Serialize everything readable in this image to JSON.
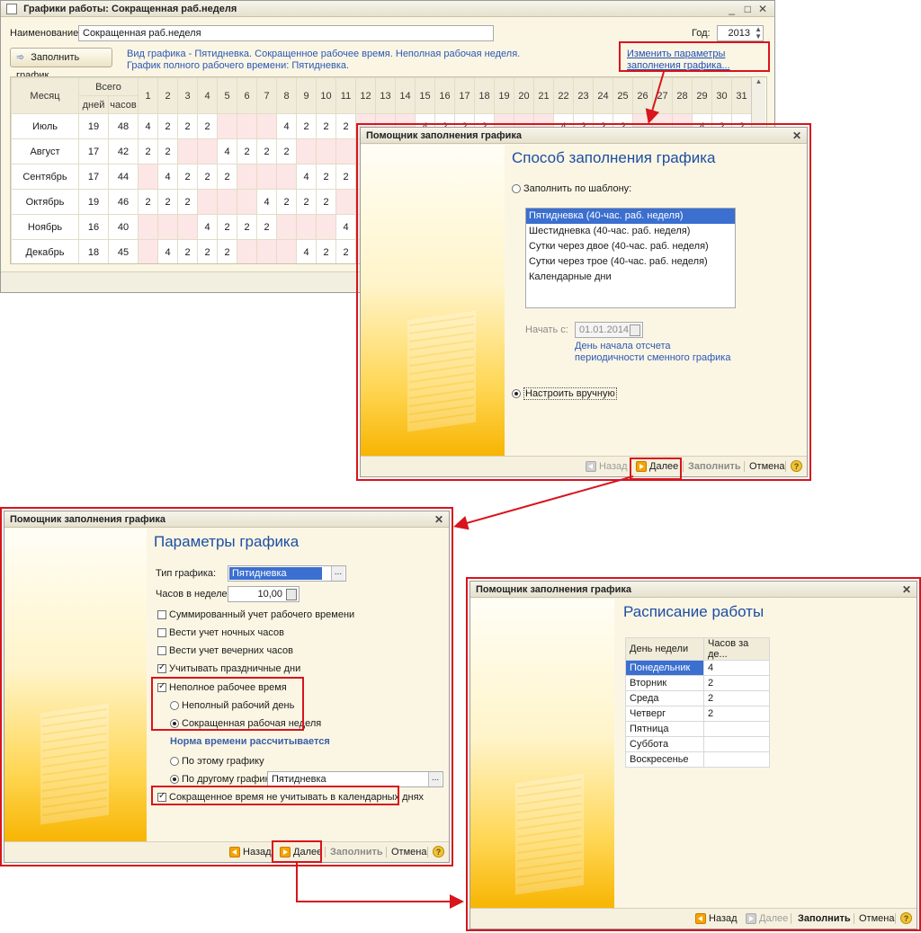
{
  "main": {
    "title": "Графики работы: Сокращенная раб.неделя",
    "name_label": "Наименование:",
    "name_value": "Сокращенная раб.неделя",
    "year_label": "Год:",
    "year_value": "2013",
    "fill_button": "Заполнить график",
    "info_line1": "Вид графика - Пятидневка. Сокращенное рабочее время. Неполная рабочая неделя.",
    "info_line2": "График полного рабочего времени: Пятидневка.",
    "change_link": "Изменить параметры заполнения графика...",
    "table": {
      "col_month": "Месяц",
      "col_total": "Всего",
      "col_days": "дней",
      "col_hours": "часов",
      "day_numbers": [
        "1",
        "2",
        "3",
        "4",
        "5",
        "6",
        "7",
        "8",
        "9",
        "10",
        "11",
        "12",
        "13",
        "14",
        "15",
        "16",
        "17",
        "18",
        "19",
        "20",
        "21",
        "22",
        "23",
        "24",
        "25",
        "26",
        "27",
        "28",
        "29",
        "30",
        "31"
      ],
      "rows": [
        {
          "month": "Июль",
          "days": "19",
          "hours": "48",
          "cells": [
            "4",
            "2",
            "2",
            "2",
            "",
            "",
            "",
            "4",
            "2",
            "2",
            "2",
            "",
            "",
            "",
            "4",
            "2",
            "2",
            "2",
            "",
            "",
            "",
            "4",
            "2",
            "2",
            "2",
            "",
            "",
            "",
            "4",
            "2",
            "2"
          ]
        },
        {
          "month": "Август",
          "days": "17",
          "hours": "42",
          "cells": [
            "2",
            "2",
            "",
            "",
            "4",
            "2",
            "2",
            "2",
            "",
            "",
            "",
            "",
            "",
            "",
            "",
            "",
            "",
            "",
            "",
            "",
            "",
            "",
            "",
            "",
            "",
            "",
            "",
            "",
            "",
            "",
            ""
          ]
        },
        {
          "month": "Сентябрь",
          "days": "17",
          "hours": "44",
          "cells": [
            "",
            "4",
            "2",
            "2",
            "2",
            "",
            "",
            "",
            "4",
            "2",
            "2",
            "",
            "",
            "",
            "",
            "",
            "",
            "",
            "",
            "",
            "",
            "",
            "",
            "",
            "",
            "",
            "",
            "",
            "",
            "",
            ""
          ]
        },
        {
          "month": "Октябрь",
          "days": "19",
          "hours": "46",
          "cells": [
            "2",
            "2",
            "2",
            "",
            "",
            "",
            "4",
            "2",
            "2",
            "2",
            "",
            "",
            "",
            "",
            "",
            "",
            "",
            "",
            "",
            "",
            "",
            "",
            "",
            "",
            "",
            "",
            "",
            "",
            "",
            "",
            ""
          ]
        },
        {
          "month": "Ноябрь",
          "days": "16",
          "hours": "40",
          "cells": [
            "",
            "",
            "",
            "4",
            "2",
            "2",
            "2",
            "",
            "",
            "",
            "4",
            "",
            "",
            "",
            "",
            "",
            "",
            "",
            "",
            "",
            "",
            "",
            "",
            "",
            "",
            "",
            "",
            "",
            "",
            "",
            ""
          ]
        },
        {
          "month": "Декабрь",
          "days": "18",
          "hours": "45",
          "cells": [
            "",
            "4",
            "2",
            "2",
            "2",
            "",
            "",
            "",
            "4",
            "2",
            "2",
            "",
            "",
            "",
            "",
            "",
            "",
            "",
            "",
            "",
            "",
            "",
            "",
            "",
            "",
            "",
            "",
            "",
            "",
            "",
            ""
          ]
        }
      ]
    }
  },
  "dialog1": {
    "title": "Помощник заполнения графика",
    "heading": "Способ заполнения графика",
    "radio_template": "Заполнить по шаблону:",
    "templates": [
      "Пятидневка (40-час. раб. неделя)",
      "Шестидневка (40-час. раб. неделя)",
      "Сутки через двое (40-час. раб. неделя)",
      "Сутки через трое (40-час. раб. неделя)",
      "Календарные дни"
    ],
    "start_label": "Начать с:",
    "start_value": "01.01.2014",
    "start_note": "День начала отсчета периодичности сменного графика",
    "radio_manual": "Настроить вручную",
    "btn_back": "Назад",
    "btn_next": "Далее",
    "btn_fill": "Заполнить",
    "btn_cancel": "Отмена"
  },
  "dialog2": {
    "title": "Помощник заполнения графика",
    "heading": "Параметры графика",
    "type_label": "Тип графика:",
    "type_value": "Пятидневка",
    "hours_label": "Часов в неделе:",
    "hours_value": "10,00",
    "cb_summary": "Суммированный учет рабочего времени",
    "cb_night": "Вести учет ночных часов",
    "cb_evening": "Вести учет вечерних часов",
    "cb_holidays": "Учитывать праздничные дни",
    "cb_partial": "Неполное рабочее время",
    "rb_partial_day": "Неполный рабочий день",
    "rb_short_week": "Сокращенная рабочая неделя",
    "norm_heading": "Норма времени рассчитывается",
    "rb_this": "По этому графику",
    "rb_other": "По другому графику:",
    "other_value": "Пятидневка",
    "cb_short_calendar": "Сокращенное время не учитывать в календарных днях",
    "btn_back": "Назад",
    "btn_next": "Далее",
    "btn_fill": "Заполнить",
    "btn_cancel": "Отмена"
  },
  "dialog3": {
    "title": "Помощник заполнения графика",
    "heading": "Расписание работы",
    "col_day": "День недели",
    "col_hours": "Часов за де...",
    "rows": [
      {
        "day": "Понедельник",
        "hours": "4"
      },
      {
        "day": "Вторник",
        "hours": "2"
      },
      {
        "day": "Среда",
        "hours": "2"
      },
      {
        "day": "Четверг",
        "hours": "2"
      },
      {
        "day": "Пятница",
        "hours": ""
      },
      {
        "day": "Суббота",
        "hours": ""
      },
      {
        "day": "Воскресенье",
        "hours": ""
      }
    ],
    "btn_back": "Назад",
    "btn_next": "Далее",
    "btn_fill": "Заполнить",
    "btn_cancel": "Отмена"
  },
  "colors": {
    "accent_red": "#d8141c",
    "link_blue": "#1f4fb8",
    "heading_blue": "#1d4ea3",
    "weekend_pink": "#fde6e6",
    "panel_yellow": "#fbf6e4"
  }
}
